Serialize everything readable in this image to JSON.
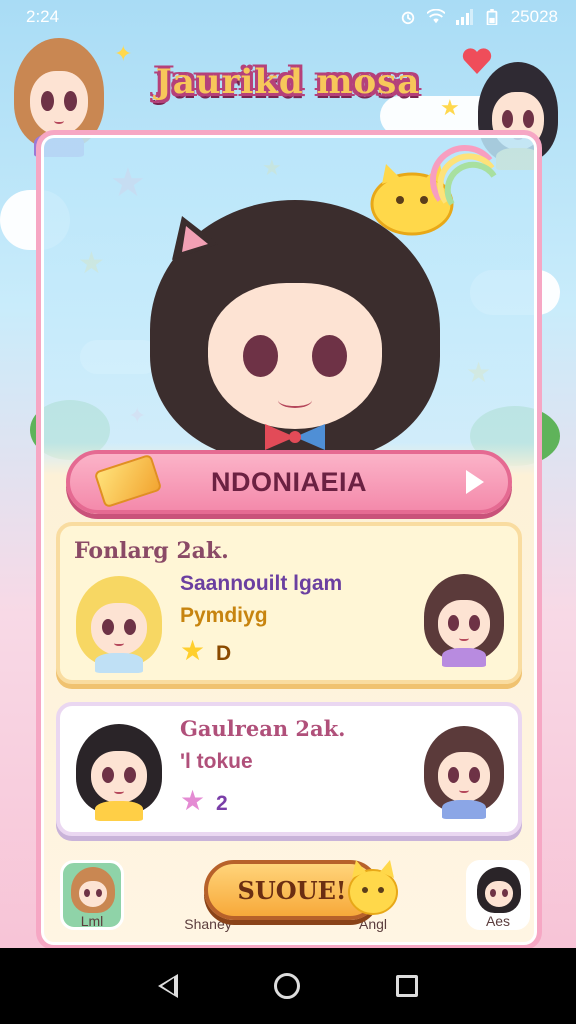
{
  "status_bar": {
    "time": "2:24",
    "right_text": "25028"
  },
  "header": {
    "title": "Jaurikd mosa"
  },
  "banner": {
    "label": "NDONIAEIA"
  },
  "cards": [
    {
      "heading": "Fonlarg 2ak.",
      "line_a": "Saannouilt lgam",
      "line_b": "Pymdiyg",
      "badge_value": "D"
    },
    {
      "heading": "Gaulrean 2ak.",
      "line_a": "",
      "line_b": "'l tokue",
      "badge_value": "2"
    }
  ],
  "bottom_tabs": [
    {
      "label": "Lml"
    },
    {
      "label": "Shaney"
    },
    {
      "label": "Angl"
    },
    {
      "label": "Aes"
    }
  ],
  "cta": {
    "label": "SUOUE!"
  },
  "colors": {
    "sky": "#a9dcf5",
    "frame": "#f6a7c4",
    "banner": "#f48aab",
    "cta": "#f7a93a"
  }
}
